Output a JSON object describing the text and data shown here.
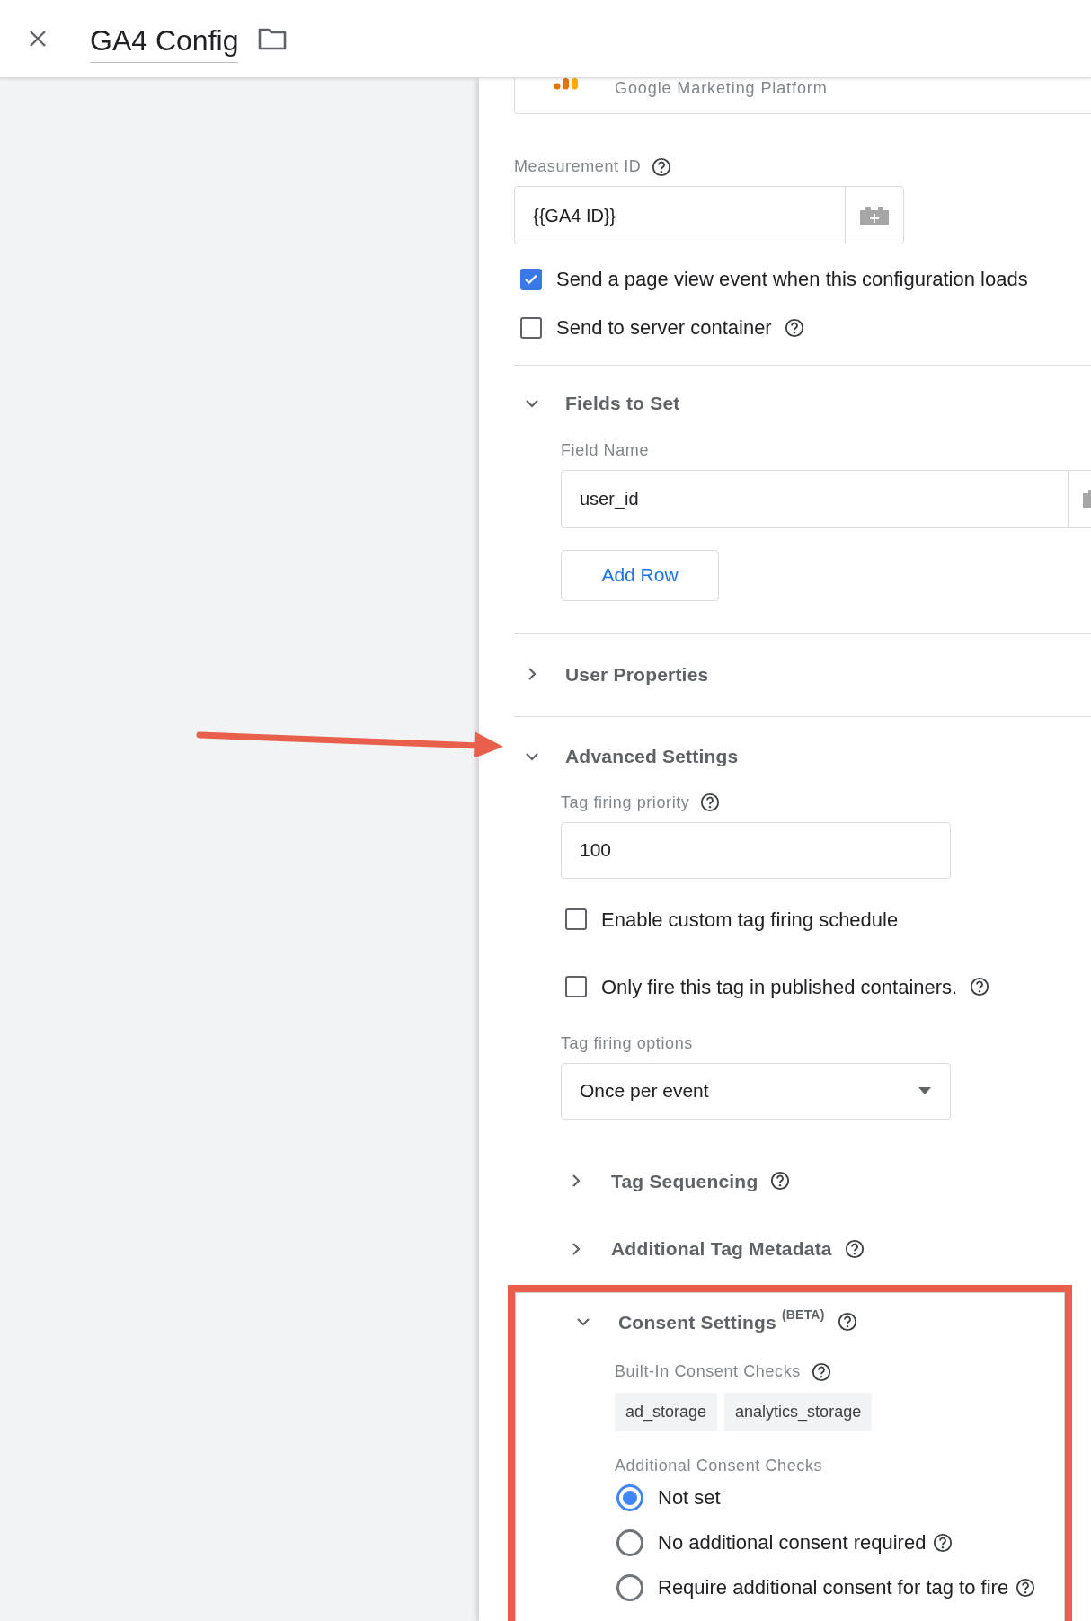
{
  "header": {
    "title": "GA4 Config"
  },
  "platform_card": {
    "text": "Google Marketing Platform"
  },
  "measurement_id": {
    "label": "Measurement ID",
    "value": "{{GA4 ID}}",
    "help": true
  },
  "checkboxes": [
    {
      "label": "Send a page view event when this configuration loads",
      "checked": true,
      "help": false
    },
    {
      "label": "Send to server container",
      "checked": false,
      "help": true
    }
  ],
  "fields_to_set": {
    "title": "Fields to Set",
    "expanded": true,
    "field_label": "Field Name",
    "field_value": "user_id",
    "add_button": "Add Row"
  },
  "user_properties": {
    "title": "User Properties",
    "expanded": false
  },
  "advanced_settings": {
    "title": "Advanced Settings",
    "expanded": true,
    "pointer_arrow": true,
    "priority_label": "Tag firing priority",
    "priority_help": true,
    "priority_value": "100",
    "checkboxes": [
      {
        "label": "Enable custom tag firing schedule",
        "checked": false,
        "help": false
      },
      {
        "label": "Only fire this tag in published containers.",
        "checked": false,
        "help": true
      }
    ],
    "options_label": "Tag firing options",
    "options_value": "Once per event",
    "subsections": [
      {
        "title": "Tag Sequencing",
        "expanded": false,
        "help": true
      },
      {
        "title": "Additional Tag Metadata",
        "expanded": false,
        "help": true
      }
    ],
    "consent": {
      "title": "Consent Settings",
      "superscript": "(BETA)",
      "expanded": true,
      "highlighted": true,
      "help": true,
      "builtin_label": "Built-In Consent Checks",
      "builtin_help": true,
      "chips": [
        "ad_storage",
        "analytics_storage"
      ],
      "additional_label": "Additional Consent Checks",
      "radios": [
        {
          "label": "Not set",
          "selected": true,
          "help": false
        },
        {
          "label": "No additional consent required",
          "selected": false,
          "help": true
        },
        {
          "label": "Require additional consent for tag to fire",
          "selected": false,
          "help": true
        }
      ]
    }
  }
}
